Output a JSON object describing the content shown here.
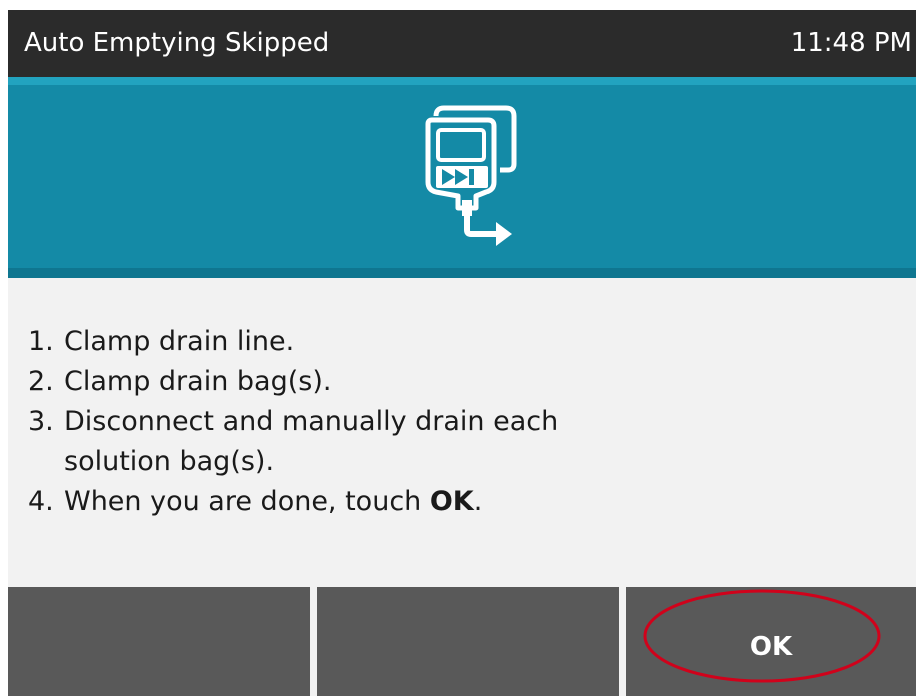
{
  "header": {
    "title": "Auto Emptying Skipped",
    "time": "11:48 PM"
  },
  "banner": {
    "icon": "drain-bag-transfer-icon"
  },
  "instructions": {
    "steps": [
      {
        "num": "1.",
        "text": "Clamp drain line."
      },
      {
        "num": "2.",
        "text": "Clamp drain bag(s)."
      },
      {
        "num": "3.",
        "text": "Disconnect and manually drain each solution bag(s)."
      },
      {
        "num": "4.",
        "text_before": "When you are done, touch ",
        "bold": "OK",
        "text_after": "."
      }
    ]
  },
  "buttons": {
    "left": "",
    "middle": "",
    "ok": "OK"
  },
  "colors": {
    "title_bar": "#2b2b2b",
    "banner": "#148aa6",
    "button": "#595959",
    "highlight": "#d0021b"
  }
}
